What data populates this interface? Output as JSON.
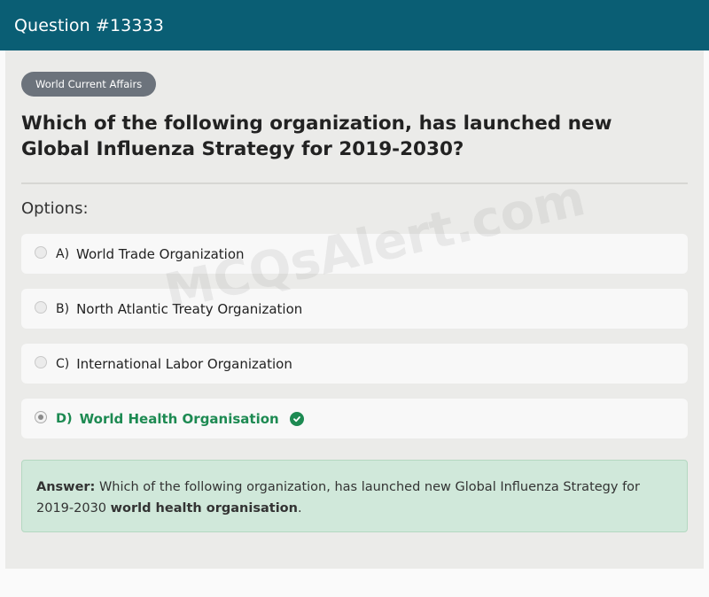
{
  "header": {
    "title": "Question #13333"
  },
  "badge": {
    "label": "World Current Affairs"
  },
  "question": {
    "text": "Which of the following organization, has launched new Global Influenza Strategy for 2019-2030?"
  },
  "options_label": "Options:",
  "options": [
    {
      "letter": "A)",
      "text": "World Trade Organization",
      "selected": false
    },
    {
      "letter": "B)",
      "text": "North Atlantic Treaty Organization",
      "selected": false
    },
    {
      "letter": "C)",
      "text": "International Labor Organization",
      "selected": false
    },
    {
      "letter": "D)",
      "text": "World Health Organisation",
      "selected": true
    }
  ],
  "answer": {
    "label": "Answer:",
    "text": "Which of the following organization, has launched new Global Influenza Strategy for 2019-2030",
    "highlight": "world health organisation",
    "suffix": "."
  },
  "watermark": "MCQsAlert.com",
  "colors": {
    "header_bg": "#0a5e74",
    "correct": "#1d8a52",
    "answer_bg": "#d0e8da"
  },
  "icons": {
    "correct": "check-circle-icon"
  }
}
